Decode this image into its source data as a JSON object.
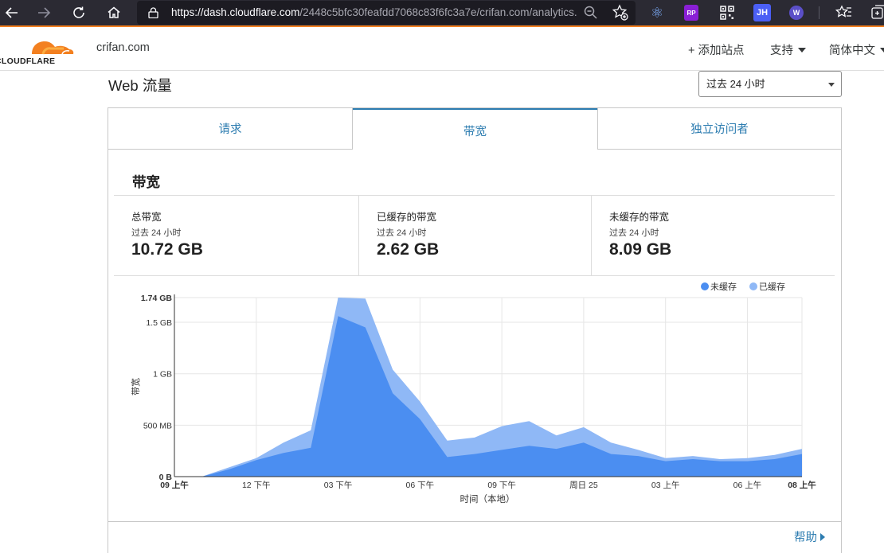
{
  "browser": {
    "url_host": "https://dash.cloudflare.com",
    "url_path": "/2448c5bfc30feafdd7068c83f6fc3a7e/crifan.com/analytics...",
    "extensions": [
      "react-devtools-icon",
      "rp-extension-icon",
      "qr-code-icon",
      "jh-extension-icon",
      "w-extension-icon"
    ],
    "ext_rp_label": "RP",
    "ext_jh_label": "JH",
    "ext_w_label": "W"
  },
  "header": {
    "logo_text": "CLOUDFLARE",
    "site": "crifan.com",
    "add_site": "+ 添加站点",
    "support": "支持",
    "language": "简体中文"
  },
  "page": {
    "section_title": "Web 流量",
    "time_range": "过去 24 小时",
    "tabs": [
      {
        "label": "请求",
        "active": false
      },
      {
        "label": "带宽",
        "active": true
      },
      {
        "label": "独立访问者",
        "active": false
      }
    ],
    "panel_heading": "带宽",
    "stats": [
      {
        "label": "总带宽",
        "sub": "过去 24 小时",
        "value": "10.72 GB"
      },
      {
        "label": "已缓存的带宽",
        "sub": "过去 24 小时",
        "value": "2.62 GB"
      },
      {
        "label": "未缓存的带宽",
        "sub": "过去 24 小时",
        "value": "8.09 GB"
      }
    ],
    "help": "帮助"
  },
  "colors": {
    "uncached": "#4b8ef1",
    "cached": "#8fb8f6",
    "accent": "#f38020",
    "link": "#2c7cb0"
  },
  "chart_data": {
    "type": "area",
    "stacked": true,
    "xlabel": "时间（本地）",
    "ylabel": "带宽",
    "y_unit": "MB",
    "ylim": [
      0,
      1740
    ],
    "y_ticks": [
      {
        "value": 0,
        "label": "0 B"
      },
      {
        "value": 500,
        "label": "500 MB"
      },
      {
        "value": 1000,
        "label": "1 GB"
      },
      {
        "value": 1500,
        "label": "1.5 GB"
      },
      {
        "value": 1740,
        "label": "1.74 GB"
      }
    ],
    "x_ticks": [
      {
        "hour": 0,
        "label": "09 上午"
      },
      {
        "hour": 3,
        "label": "12 下午"
      },
      {
        "hour": 6,
        "label": "03 下午"
      },
      {
        "hour": 9,
        "label": "06 下午"
      },
      {
        "hour": 12,
        "label": "09 下午"
      },
      {
        "hour": 15,
        "label": "周日 25"
      },
      {
        "hour": 18,
        "label": "03 上午"
      },
      {
        "hour": 21,
        "label": "06 上午"
      },
      {
        "hour": 23,
        "label": "08 上午"
      }
    ],
    "x": [
      0,
      1,
      2,
      3,
      4,
      5,
      6,
      7,
      8,
      9,
      10,
      11,
      12,
      13,
      14,
      15,
      16,
      17,
      18,
      19,
      20,
      21,
      22,
      23
    ],
    "series": [
      {
        "name": "未缓存",
        "values": [
          0,
          0,
          70,
          160,
          230,
          280,
          1560,
          1450,
          810,
          560,
          190,
          220,
          260,
          300,
          270,
          330,
          220,
          200,
          150,
          170,
          150,
          150,
          170,
          220
        ]
      },
      {
        "name": "已缓存",
        "values": [
          0,
          0,
          20,
          20,
          100,
          170,
          180,
          280,
          230,
          170,
          160,
          160,
          230,
          240,
          130,
          150,
          110,
          60,
          30,
          30,
          20,
          30,
          40,
          50
        ]
      }
    ],
    "legend_position": "top-right",
    "grid": true
  }
}
